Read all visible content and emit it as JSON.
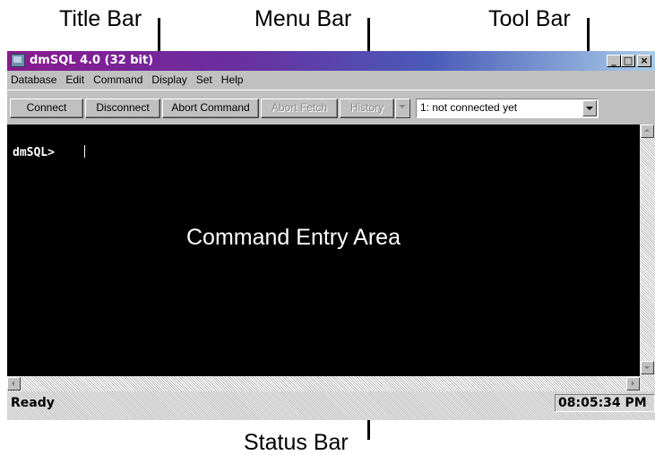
{
  "callouts": {
    "title_bar": "Title Bar",
    "menu_bar": "Menu Bar",
    "tool_bar": "Tool Bar",
    "command_entry_area": "Command Entry Area",
    "status_bar": "Status Bar"
  },
  "window": {
    "title": "dmSQL 4.0 (32 bit)",
    "controls": {
      "minimize": "_",
      "maximize": "□",
      "close": "×"
    }
  },
  "menu": {
    "items": [
      {
        "label": "Database"
      },
      {
        "label": "Edit"
      },
      {
        "label": "Command"
      },
      {
        "label": "Display"
      },
      {
        "label": "Set"
      },
      {
        "label": "Help"
      }
    ]
  },
  "toolbar": {
    "connect": "Connect",
    "disconnect": "Disconnect",
    "abort_command": "Abort Command",
    "abort_fetch": "Abort Fetch",
    "history": "History",
    "connection_select": "1: not connected yet"
  },
  "console": {
    "prompt": "dmSQL>"
  },
  "status": {
    "text": "Ready",
    "time": "08:05:34 PM"
  },
  "colors": {
    "title_gradient_start": "#8a1a8e",
    "title_gradient_end": "#a8cce8",
    "console_bg": "#000000",
    "chrome": "#c0c0c0"
  }
}
